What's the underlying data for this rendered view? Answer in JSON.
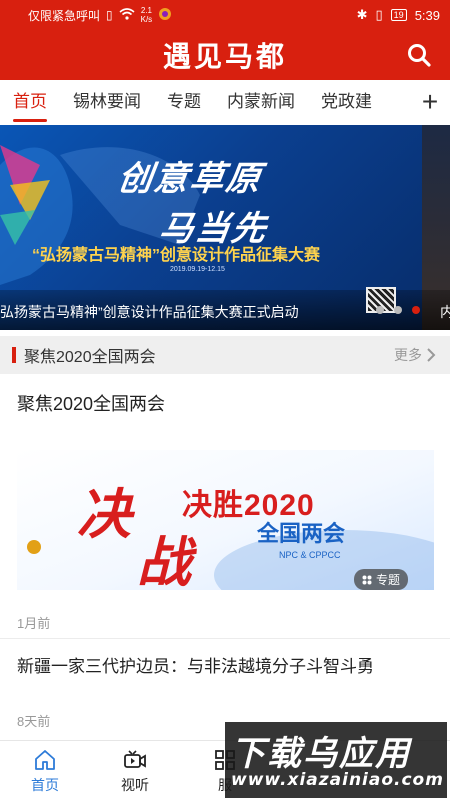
{
  "status_bar": {
    "carrier": "仅限紧急呼叫",
    "speed_value": "2.1",
    "speed_unit": "K/s",
    "battery": "19",
    "time": "5:39"
  },
  "header": {
    "title": "遇见马都"
  },
  "tabs": [
    {
      "label": "首页",
      "active": true
    },
    {
      "label": "锡林要闻",
      "active": false
    },
    {
      "label": "专题",
      "active": false
    },
    {
      "label": "内蒙新闻",
      "active": false
    },
    {
      "label": "党政建",
      "active": false
    }
  ],
  "tab_add_label": "+",
  "carousel": {
    "banner_title_1": "创意草原",
    "banner_title_2": "马当先",
    "banner_subtitle": "“弘扬蒙古马精神”创意设计作品征集大赛",
    "banner_date": "2019.09.19-12.15",
    "caption": "弘扬蒙古马精神”创意设计作品征集大赛正式启动",
    "next_caption": "内",
    "slide_count": 3,
    "active_index": 2
  },
  "section": {
    "title": "聚焦2020全国两会",
    "more": "更多"
  },
  "feature": {
    "title": "聚焦2020全国两会",
    "image_char_1": "决",
    "image_char_2": "战",
    "image_headline": "决胜2020",
    "image_subhead": "全国两会",
    "image_npc": "NPC & CPPCC",
    "badge": "专题",
    "time": "1月前"
  },
  "news": [
    {
      "title": "新疆一家三代护边员：与非法越境分子斗智斗勇",
      "time": "8天前"
    }
  ],
  "bottom_nav": [
    {
      "label": "首页",
      "icon": "home-icon",
      "active": true
    },
    {
      "label": "视听",
      "icon": "video-icon",
      "active": false
    },
    {
      "label": "服",
      "icon": "grid-icon",
      "active": false
    }
  ],
  "watermark": {
    "top": "下载乌应用",
    "bottom": "www.xiazainiao.com"
  },
  "colors": {
    "brand_red": "#d8200f",
    "nav_active_blue": "#2d7bd8"
  }
}
